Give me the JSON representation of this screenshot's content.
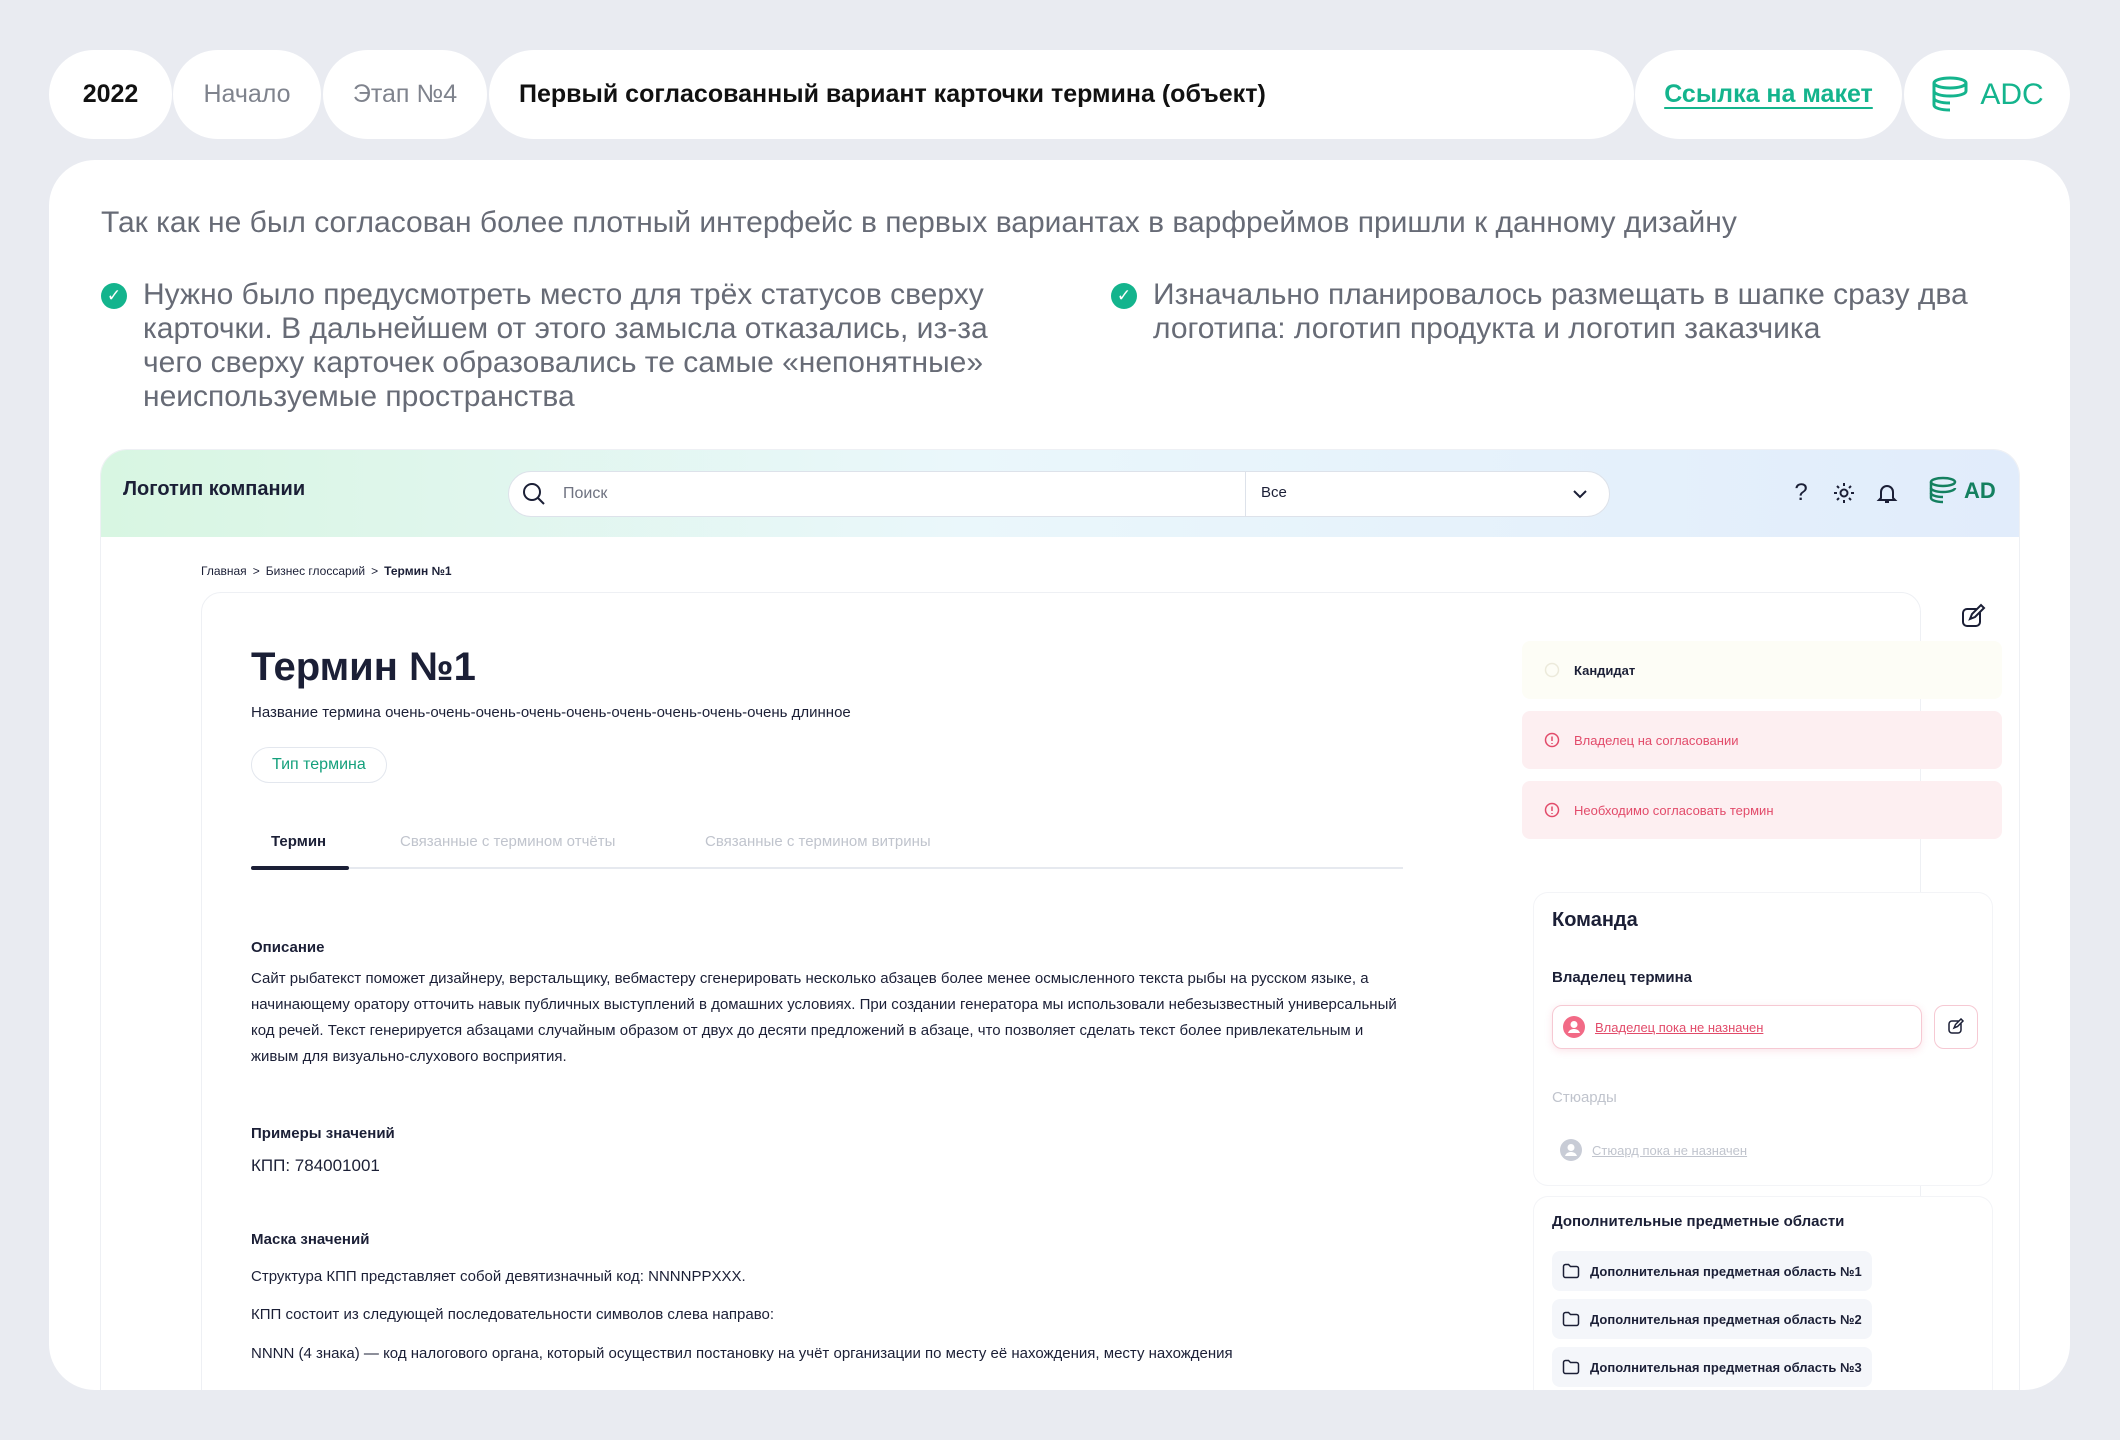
{
  "top": {
    "year": "2022",
    "start": "Начало",
    "stage": "Этап №4",
    "title": "Первый согласованный вариант карточки термина (объект)",
    "link": "Ссылка  на макет",
    "logo_text": "ADC"
  },
  "intro": "Так как не был согласован более плотный интерфейс в первых вариантах в варфреймов пришли к данному дизайну",
  "notes": [
    "Нужно было предусмотреть место для трёх статусов сверху карточки. В дальнейшем от этого замысла отказались, из-за чего сверху карточек образовались те самые «непонятные» неиспользуемые пространства",
    "Изначально планировалось размещать в шапке сразу два логотипа: логотип продукта и логотип заказчика"
  ],
  "colors": {
    "accent": "#14b48d",
    "danger": "#e24b6a",
    "text": "#1b1f36"
  },
  "app": {
    "company": "Логотип компании",
    "search_placeholder": "Поиск",
    "select_value": "Все",
    "logo_text": "AD",
    "header_icons": [
      "help-icon",
      "gear-icon",
      "bell-icon"
    ],
    "breadcrumbs": [
      "Главная",
      "Бизнес глоссарий",
      "Термин №1"
    ],
    "term": {
      "title": "Термин №1",
      "name": "Название термина очень-очень-очень-очень-очень-очень-очень-очень-очень длинное",
      "type": "Тип термина"
    },
    "tabs": [
      "Термин",
      "Связанные с термином отчёты",
      "Связанные с термином витрины"
    ],
    "description_h": "Описание",
    "description": "Сайт рыбатекст поможет дизайнеру, верстальщику, вебмастеру сгенерировать несколько абзацев более менее осмысленного текста рыбы на русском языке, а начинающему оратору отточить навык публичных выступлений в домашних условиях. При создании генератора мы использовали небезызвестный универсальный код речей. Текст генерируется абзацами случайным образом от двух до десяти предложений в абзаце, что позволяет сделать текст более привлекательным и живым для визуально-слухового восприятия.",
    "examples_h": "Примеры значений",
    "examples": "КПП: 784001001",
    "mask_h": "Маска значений",
    "mask_lines": [
      "Структура КПП представляет собой девятизначный код: NNNNPPXXX.",
      "КПП состоит из следующей последовательности символов слева направо:",
      "NNNN (4 знака) — код налогового органа, который осуществил постановку на учёт организации по месту её нахождения, месту нахождения"
    ],
    "statuses": [
      "Кандидат",
      "Владелец  на согласовании",
      "Необходимо согласовать термин"
    ],
    "team": {
      "title": "Команда",
      "owner_h": "Владелец термина",
      "owner_value": "Владелец пока не назначен",
      "stewards_h": "Стюарды",
      "steward_value": "Стюард пока не назначен"
    },
    "areas": {
      "title": "Дополнительные предметные области",
      "items": [
        "Дополнительная предметная область №1",
        "Дополнительная предметная область №2",
        "Дополнительная предметная область №3"
      ]
    }
  }
}
